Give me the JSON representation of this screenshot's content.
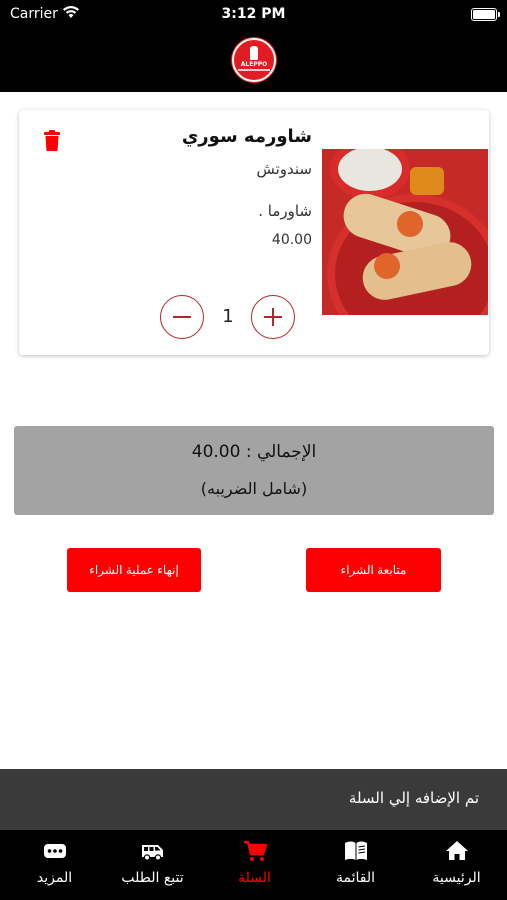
{
  "status_bar": {
    "carrier": "Carrier",
    "time": "3:12 PM"
  },
  "header": {
    "logo_text": "ALEPPO"
  },
  "cart_item": {
    "name": "شاورمه سوري",
    "category": "سندوتش",
    "description": "شاورما .",
    "price": "40.00",
    "quantity": "1"
  },
  "summary": {
    "total": "40.00 : الإجمالي",
    "tax_note": "(شامل الضريبه)"
  },
  "actions": {
    "finish_label": "إنهاء عملية الشراء",
    "continue_label": "متابعة الشراء"
  },
  "toast": {
    "message": "تم الإضافه إلي السلة"
  },
  "tabs": [
    {
      "label": "الرئيسية",
      "icon": "home-icon"
    },
    {
      "label": "القائمة",
      "icon": "menu-book-icon"
    },
    {
      "label": "السلة",
      "icon": "cart-icon",
      "active": true
    },
    {
      "label": "تتبع الطلب",
      "icon": "van-icon"
    },
    {
      "label": "المزيد",
      "icon": "more-icon"
    }
  ],
  "colors": {
    "accent": "#ff0000",
    "header_bg": "#000000",
    "total_bg": "#a3a3a3",
    "toast_bg": "#3a3a3a",
    "qty_border": "#b3262a"
  }
}
